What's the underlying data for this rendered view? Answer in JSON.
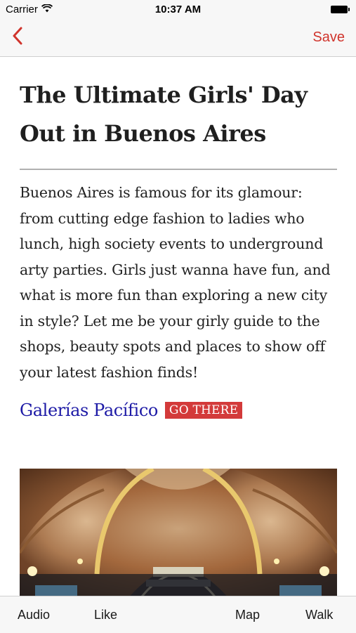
{
  "status_bar": {
    "carrier": "Carrier",
    "time": "10:37 AM",
    "icons": [
      "wifi-icon",
      "battery-icon"
    ]
  },
  "nav": {
    "back_icon": "chevron-left-icon",
    "save_label": "Save",
    "accent_color": "#d0342c"
  },
  "article": {
    "title": "The Ultimate Girls' Day Out in Buenos Aires",
    "intro": "Buenos Aires is famous for its glamour: from cutting edge fashion to ladies who lunch, high society events to underground arty parties. Girls just wanna have fun, and what is more fun than exploring a new city in style? Let me be your girly guide to the shops, beauty spots and places to show off your latest fashion finds!",
    "places": [
      {
        "name": "Galerías Pacífico",
        "action_label": "GO THERE",
        "link_color": "#1d1aa6",
        "action_color": "#d33a3a"
      }
    ]
  },
  "tab_bar": {
    "items": [
      {
        "label": "Audio"
      },
      {
        "label": "Like"
      },
      {
        "label": "Map"
      },
      {
        "label": "Walk"
      }
    ]
  }
}
